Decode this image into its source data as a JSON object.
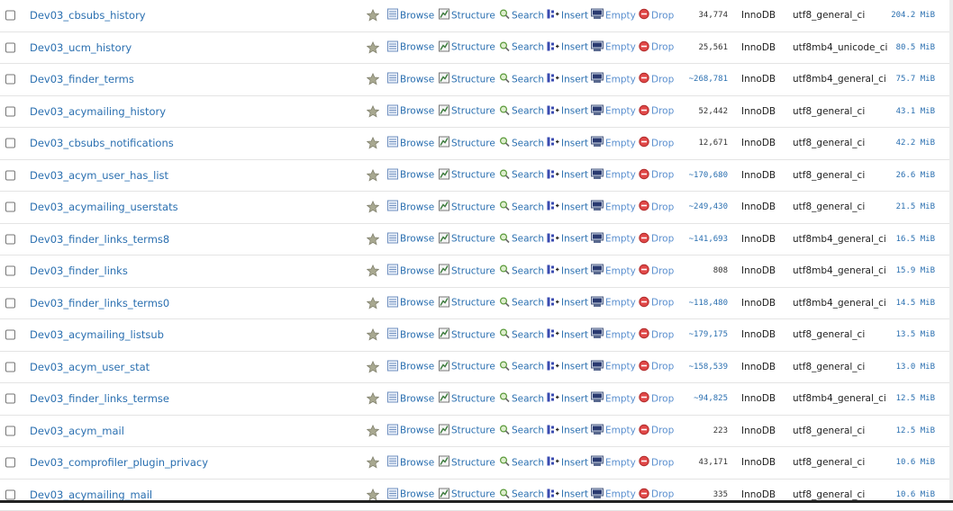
{
  "actions": {
    "browse": "Browse",
    "structure": "Structure",
    "search": "Search",
    "insert": "Insert",
    "empty": "Empty",
    "drop": "Drop"
  },
  "tables": [
    {
      "name": "Dev03_cbsubs_history",
      "rows": "34,774",
      "approx": false,
      "engine": "InnoDB",
      "collation": "utf8_general_ci",
      "size": "204.2 MiB"
    },
    {
      "name": "Dev03_ucm_history",
      "rows": "25,561",
      "approx": false,
      "engine": "InnoDB",
      "collation": "utf8mb4_unicode_ci",
      "size": "80.5 MiB"
    },
    {
      "name": "Dev03_finder_terms",
      "rows": "~268,781",
      "approx": true,
      "engine": "InnoDB",
      "collation": "utf8mb4_general_ci",
      "size": "75.7 MiB"
    },
    {
      "name": "Dev03_acymailing_history",
      "rows": "52,442",
      "approx": false,
      "engine": "InnoDB",
      "collation": "utf8_general_ci",
      "size": "43.1 MiB"
    },
    {
      "name": "Dev03_cbsubs_notifications",
      "rows": "12,671",
      "approx": false,
      "engine": "InnoDB",
      "collation": "utf8_general_ci",
      "size": "42.2 MiB"
    },
    {
      "name": "Dev03_acym_user_has_list",
      "rows": "~170,680",
      "approx": true,
      "engine": "InnoDB",
      "collation": "utf8_general_ci",
      "size": "26.6 MiB"
    },
    {
      "name": "Dev03_acymailing_userstats",
      "rows": "~249,430",
      "approx": true,
      "engine": "InnoDB",
      "collation": "utf8_general_ci",
      "size": "21.5 MiB"
    },
    {
      "name": "Dev03_finder_links_terms8",
      "rows": "~141,693",
      "approx": true,
      "engine": "InnoDB",
      "collation": "utf8mb4_general_ci",
      "size": "16.5 MiB"
    },
    {
      "name": "Dev03_finder_links",
      "rows": "808",
      "approx": false,
      "engine": "InnoDB",
      "collation": "utf8mb4_general_ci",
      "size": "15.9 MiB"
    },
    {
      "name": "Dev03_finder_links_terms0",
      "rows": "~118,480",
      "approx": true,
      "engine": "InnoDB",
      "collation": "utf8mb4_general_ci",
      "size": "14.5 MiB"
    },
    {
      "name": "Dev03_acymailing_listsub",
      "rows": "~179,175",
      "approx": true,
      "engine": "InnoDB",
      "collation": "utf8_general_ci",
      "size": "13.5 MiB"
    },
    {
      "name": "Dev03_acym_user_stat",
      "rows": "~158,539",
      "approx": true,
      "engine": "InnoDB",
      "collation": "utf8_general_ci",
      "size": "13.0 MiB"
    },
    {
      "name": "Dev03_finder_links_termse",
      "rows": "~94,825",
      "approx": true,
      "engine": "InnoDB",
      "collation": "utf8mb4_general_ci",
      "size": "12.5 MiB"
    },
    {
      "name": "Dev03_acym_mail",
      "rows": "223",
      "approx": false,
      "engine": "InnoDB",
      "collation": "utf8_general_ci",
      "size": "12.5 MiB"
    },
    {
      "name": "Dev03_comprofiler_plugin_privacy",
      "rows": "43,171",
      "approx": false,
      "engine": "InnoDB",
      "collation": "utf8_general_ci",
      "size": "10.6 MiB"
    },
    {
      "name": "Dev03_acymailing_mail",
      "rows": "335",
      "approx": false,
      "engine": "InnoDB",
      "collation": "utf8_general_ci",
      "size": "10.6 MiB"
    }
  ],
  "colors": {
    "link": "#2a6fb0",
    "action_muted": "#5a8fcf",
    "drop_icon": "#e04848",
    "star": "#9a9a8a"
  },
  "icons": [
    "checkbox",
    "favorite-star-icon",
    "browse-icon",
    "structure-icon",
    "search-icon",
    "insert-icon",
    "empty-icon",
    "drop-icon"
  ]
}
